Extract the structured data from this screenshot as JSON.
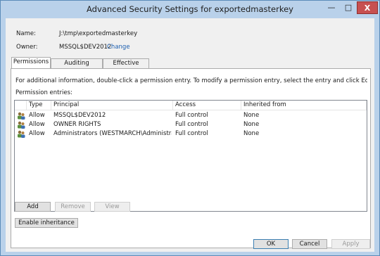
{
  "window": {
    "title": "Advanced Security Settings for exportedmasterkey",
    "minimize_glyph": "—",
    "maximize_glyph": "□",
    "close_glyph": "X"
  },
  "info": {
    "name_label": "Name:",
    "name_value": "J:\\tmp\\exportedmasterkey",
    "owner_label": "Owner:",
    "owner_value": "MSSQL$DEV2012",
    "change_link": "Change"
  },
  "tabs": [
    {
      "label": "Permissions",
      "active": true
    },
    {
      "label": "Auditing",
      "active": false
    },
    {
      "label": "Effective Access",
      "active": false
    }
  ],
  "permissions": {
    "description": "For additional information, double-click a permission entry. To modify a permission entry, select the entry and click Edit (if available).",
    "entries_label": "Permission entries:",
    "columns": [
      "Type",
      "Principal",
      "Access",
      "Inherited from"
    ],
    "rows": [
      {
        "icon": "users-icon",
        "type": "Allow",
        "principal": "MSSQL$DEV2012",
        "access": "Full control",
        "inherited": "None"
      },
      {
        "icon": "users-icon",
        "type": "Allow",
        "principal": "OWNER RIGHTS",
        "access": "Full control",
        "inherited": "None"
      },
      {
        "icon": "users-icon",
        "type": "Allow",
        "principal": "Administrators (WESTMARCH\\Administrat...",
        "access": "Full control",
        "inherited": "None"
      }
    ],
    "buttons": {
      "add": "Add",
      "remove": "Remove",
      "view": "View",
      "enable_inheritance": "Enable inheritance"
    }
  },
  "footer": {
    "ok": "OK",
    "cancel": "Cancel",
    "apply": "Apply"
  },
  "colors": {
    "title_bar": "#b9d1ea",
    "close_button": "#c75050",
    "link": "#1c5fb0"
  }
}
